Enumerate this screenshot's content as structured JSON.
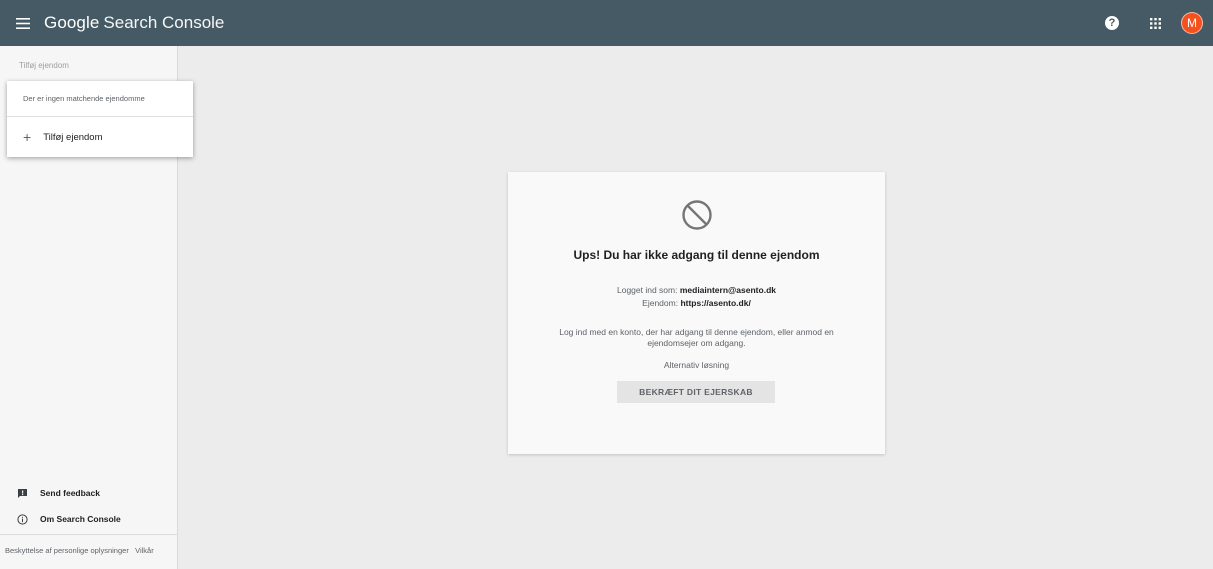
{
  "topbar": {
    "brand_google": "Google",
    "brand_product": "Search Console",
    "help_label": "?",
    "avatar_initial": "M",
    "colors": {
      "bar": "#455a64",
      "avatar": "#f4511e"
    }
  },
  "sidebar": {
    "property_selector_label": "Tilføj ejendom",
    "links": [
      {
        "label": "Send feedback",
        "icon": "feedback-icon"
      },
      {
        "label": "Om Search Console",
        "icon": "info-icon"
      }
    ],
    "legal": {
      "privacy": "Beskyttelse af personlige oplysninger",
      "terms": "Vilkår"
    }
  },
  "dropdown": {
    "no_match": "Der er ingen matchende ejendomme",
    "add_property": "Tilføj ejendom"
  },
  "card": {
    "icon": "block-icon",
    "title": "Ups! Du har ikke adgang til denne ejendom",
    "logged_in_prefix": "Logget ind som:",
    "logged_in_email": "mediaintern@asento.dk",
    "property_prefix": "Ejendom:",
    "property_url": "https://asento.dk/",
    "description": "Log ind med en konto, der har adgang til denne ejendom, eller anmod en ejendomsejer om adgang.",
    "alternative": "Alternativ løsning",
    "verify_button": "BEKRÆFT DIT EJERSKAB"
  }
}
